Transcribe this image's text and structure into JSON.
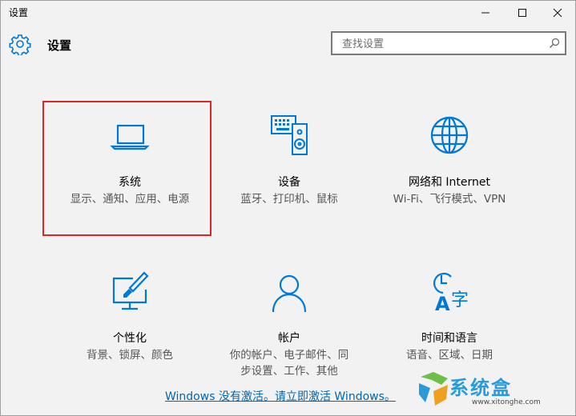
{
  "window": {
    "title": "设置",
    "controls": {
      "minimize": "–",
      "maximize": "□",
      "close": "✕"
    }
  },
  "header": {
    "title": "设置",
    "icon": "gear-icon"
  },
  "search": {
    "placeholder": "查找设置",
    "icon": "search-icon"
  },
  "tiles": [
    {
      "name": "系统",
      "desc": "显示、通知、应用、电源",
      "icon": "laptop-icon"
    },
    {
      "name": "设备",
      "desc": "蓝牙、打印机、鼠标",
      "icon": "devices-icon"
    },
    {
      "name": "网络和 Internet",
      "desc": "Wi-Fi、飞行模式、VPN",
      "icon": "globe-icon"
    },
    {
      "name": "个性化",
      "desc": "背景、锁屏、颜色",
      "icon": "personalization-icon"
    },
    {
      "name": "帐户",
      "desc": "你的帐户、电子邮件、同步设置、工作、其他",
      "icon": "account-icon"
    },
    {
      "name": "时间和语言",
      "desc": "语音、区域、日期",
      "icon": "time-language-icon"
    }
  ],
  "activation_link": "Windows 没有激活。请立即激活 Windows。",
  "watermark": {
    "text": "系统盒",
    "url": "www.xitonghe.com"
  },
  "colors": {
    "accent": "#0078d7",
    "highlight": "#e02323",
    "link": "#0066b4"
  }
}
